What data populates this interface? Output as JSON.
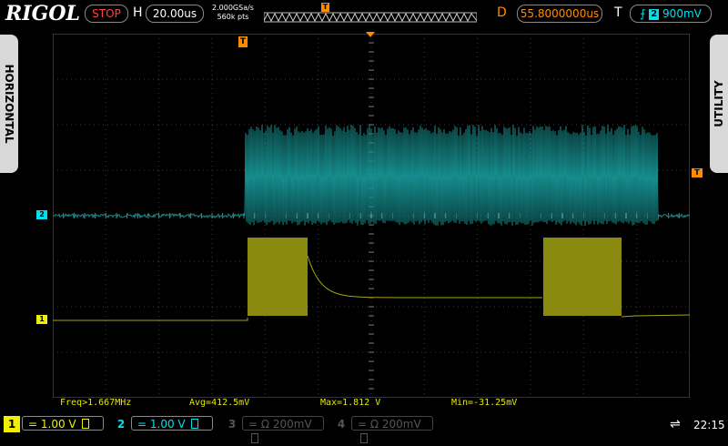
{
  "brand": "RIGOL",
  "status": {
    "run_state": "STOP"
  },
  "horizontal": {
    "label": "H",
    "timebase": "20.00us",
    "sample_rate": "2.000GSa/s",
    "memory_depth": "560k pts"
  },
  "delay": {
    "label": "D",
    "value": "55.8000000us"
  },
  "trigger": {
    "label": "T",
    "channel": "2",
    "level": "900mV"
  },
  "side_tabs": {
    "left": "HORIZONTAL",
    "right": "UTILITY"
  },
  "markers": {
    "trigger_position": "T",
    "trigger_level": "T",
    "ch1": "1",
    "ch2": "2"
  },
  "measurements": {
    "freq": "Freq>1.667MHz",
    "avg": "Avg=412.5mV",
    "max": "Max=1.812 V",
    "min": "Min=-31.25mV"
  },
  "channels": [
    {
      "num": "1",
      "coupling": "=",
      "scale": "1.00 V",
      "color": "#f0f000",
      "active": true
    },
    {
      "num": "2",
      "coupling": "=",
      "scale": "1.00 V",
      "color": "#00e0f0",
      "active": true
    },
    {
      "num": "3",
      "coupling": "=",
      "scale": "Ω 200mV",
      "color": "#555555",
      "active": false
    },
    {
      "num": "4",
      "coupling": "=",
      "scale": "Ω 200mV",
      "color": "#555555",
      "active": false
    }
  ],
  "clock": "22:15",
  "icons": {
    "usb": "usb-icon",
    "battery": "battery-icon",
    "trigger_edge": "rising-edge-icon"
  },
  "colors": {
    "ch1_trace": "#a3a318",
    "ch2_trace": "#168c8c",
    "trigger_marker": "#ff8c00",
    "stop": "#ff4040"
  }
}
